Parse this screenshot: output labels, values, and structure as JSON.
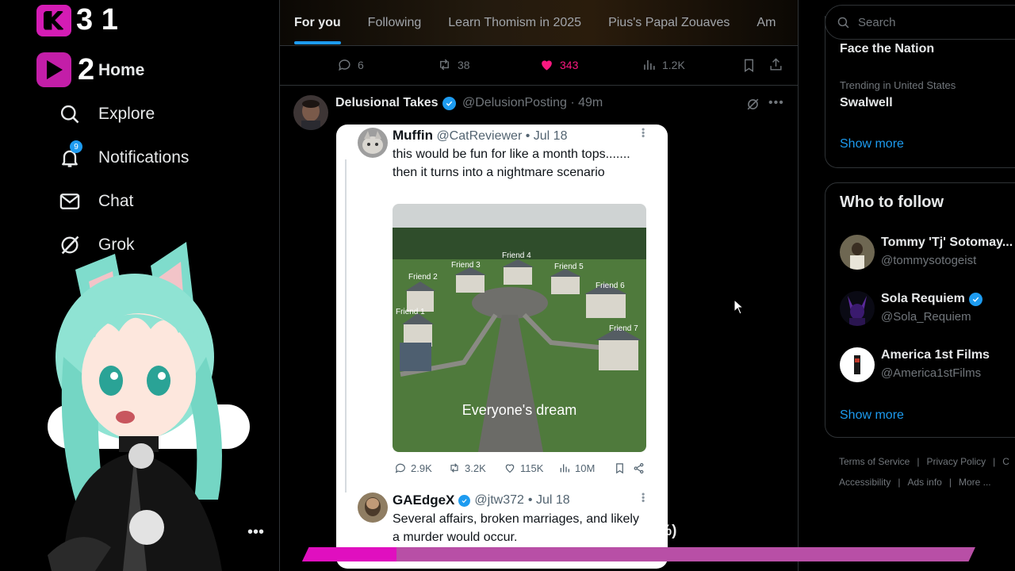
{
  "overlay": {
    "counter_top": "3 1",
    "counter_bottom": "2",
    "progress_text": "5 / 35 (14%)",
    "progress_fraction": 0.14
  },
  "nav": {
    "items": [
      {
        "label": "Home",
        "icon": "home-icon"
      },
      {
        "label": "Explore",
        "icon": "search-icon"
      },
      {
        "label": "Notifications",
        "icon": "bell-icon",
        "badge": "9"
      },
      {
        "label": "Chat",
        "icon": "mail-icon"
      },
      {
        "label": "Grok",
        "icon": "grok-icon"
      }
    ]
  },
  "feed": {
    "tabs": [
      "For you",
      "Following",
      "Learn Thomism in 2025",
      "Pius's Papal Zouaves",
      "Am"
    ],
    "active_tab": "For you",
    "prev_actions": {
      "replies": "6",
      "reposts": "38",
      "likes": "343",
      "views": "1.2K"
    },
    "post": {
      "name": "Delusional Takes",
      "handle": "@DelusionPosting",
      "time": "· 49m",
      "embed": {
        "tweet1": {
          "name": "Muffin",
          "handle": "@CatReviewer",
          "date": "• Jul 18",
          "text": "this would be fun for like a month tops....... then it turns into a nightmare scenario",
          "image_caption": "Everyone's dream",
          "image_labels": [
            "Friend 1",
            "Friend 2",
            "Friend 3",
            "Friend 4",
            "Friend 5",
            "Friend 6",
            "Friend 7"
          ],
          "stats": {
            "replies": "2.9K",
            "reposts": "3.2K",
            "likes": "115K",
            "views": "10M"
          }
        },
        "tweet2": {
          "name": "GAEdgeX",
          "handle": "@jtw372",
          "date": "• Jul 18",
          "text": "Several affairs, broken marriages, and likely a murder would occur."
        }
      }
    }
  },
  "sidebar_right": {
    "search_placeholder": "Search",
    "trends": [
      {
        "context": "",
        "title": "Face the Nation"
      },
      {
        "context": "Trending in United States",
        "title": "Swalwell"
      }
    ],
    "trends_show_more": "Show more",
    "who_to_follow_title": "Who to follow",
    "who_to_follow": [
      {
        "name": "Tommy 'Tj' Sotomay...",
        "handle": "@tommysotogeist",
        "verified": false
      },
      {
        "name": "Sola Requiem",
        "handle": "@Sola_Requiem",
        "verified": true
      },
      {
        "name": "America 1st Films",
        "handle": "@America1stFilms",
        "verified": false
      }
    ],
    "wtf_show_more": "Show more",
    "footer": [
      "Terms of Service",
      "Privacy Policy",
      "C",
      "Accessibility",
      "Ads info",
      "More ..."
    ]
  },
  "colors": {
    "accent": "#1d9bf0",
    "like": "#f91880",
    "progress": "#e00fbf"
  }
}
